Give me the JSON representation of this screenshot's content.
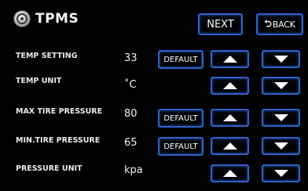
{
  "header": {
    "title": "TPMS",
    "next_label": "NEXT",
    "back_label": "BACK",
    "back_icon": "back-arrow-icon"
  },
  "settings": {
    "rows": [
      {
        "label": "TEMP SETTING",
        "value": "33",
        "default_label": "DEFAULT"
      },
      {
        "label": "TEMP UNIT",
        "value": "˚C"
      },
      {
        "label": "MAX TIRE PRESSURE",
        "value": "80",
        "default_label": "DEFAULT"
      },
      {
        "label": "MIN.TIRE PRESSURE",
        "value": "65",
        "default_label": "DEFAULT"
      },
      {
        "label": "PRESSURE UNIT",
        "value": "kpa"
      }
    ]
  },
  "colors": {
    "button_border": "#2e62c9",
    "background": "#020203",
    "text": "#ffffff"
  }
}
